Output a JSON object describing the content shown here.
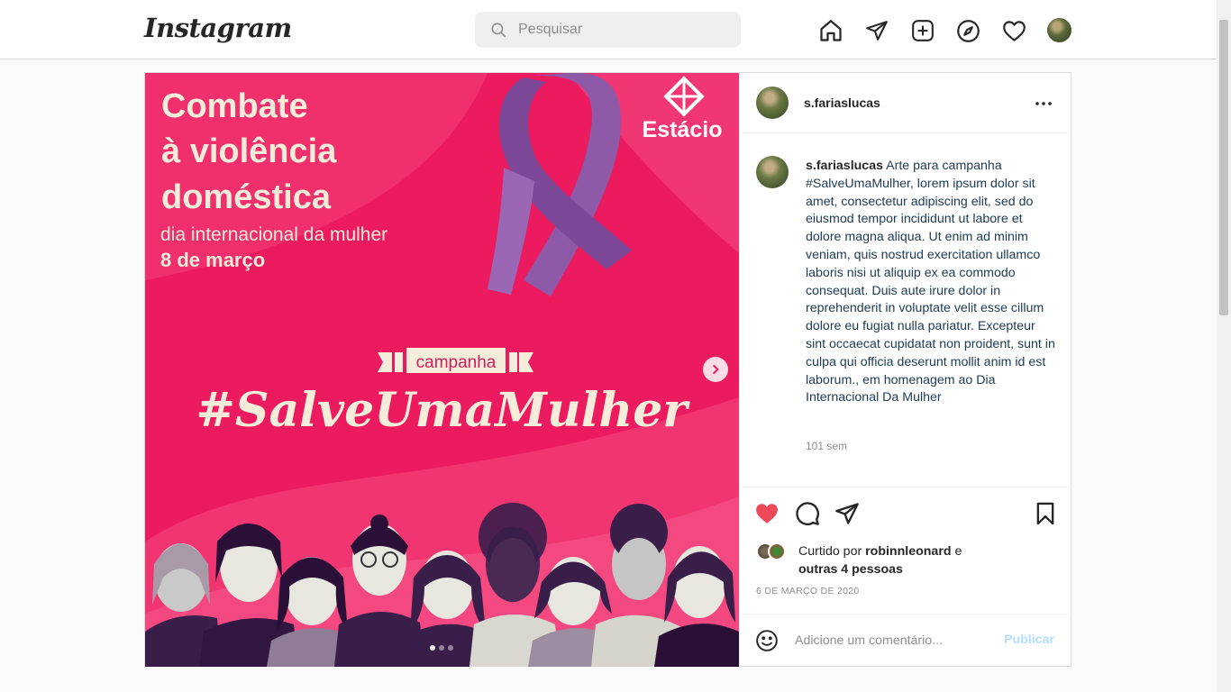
{
  "app": {
    "logo_text": "Instagram"
  },
  "search": {
    "placeholder": "Pesquisar",
    "value": ""
  },
  "nav": {
    "icons": [
      "home-icon",
      "direct-icon",
      "new-post-icon",
      "explore-icon",
      "activity-icon",
      "profile-avatar"
    ]
  },
  "post": {
    "username": "s.fariaslucas",
    "image": {
      "headline_line1": "Combate",
      "headline_line2": "à violência",
      "headline_line3": "doméstica",
      "subline": "dia internacional da mulher",
      "date_line": "8 de março",
      "brand": "Estácio",
      "ribbon_label": "campanha",
      "hashtag": "#SalveUmaMulher",
      "slide_count": 3,
      "active_slide": 1
    },
    "caption": {
      "username": "s.fariaslucas",
      "text": "Arte para campanha #SalveUmaMulher, lorem ipsum dolor sit amet, consectetur adipiscing elit, sed do eiusmod tempor incididunt ut labore et dolore magna aliqua. Ut enim ad minim veniam, quis nostrud exercitation ullamco laboris nisi ut aliquip ex ea commodo consequat. Duis aute irure dolor in reprehenderit in voluptate velit esse cillum dolore eu fugiat nulla pariatur. Excepteur sint occaecat cupidatat non proident, sunt in culpa qui officia deserunt mollit anim id est laborum., em homenagem ao Dia Internacional Da Mulher",
      "age": "101 sem"
    },
    "likes": {
      "prefix": "Curtido por",
      "user": "robinnleonard",
      "conjunction": "e",
      "others": "outras 4 pessoas"
    },
    "date": "6 DE MARÇO DE 2020",
    "comment": {
      "placeholder": "Adicione um comentário...",
      "publish_label": "Publicar"
    }
  },
  "colors": {
    "like_red": "#ed4956",
    "publish_disabled": "#b2dffc",
    "image_pink": "#ec1a5f",
    "ribbon_purple": "#8e5aa8"
  }
}
